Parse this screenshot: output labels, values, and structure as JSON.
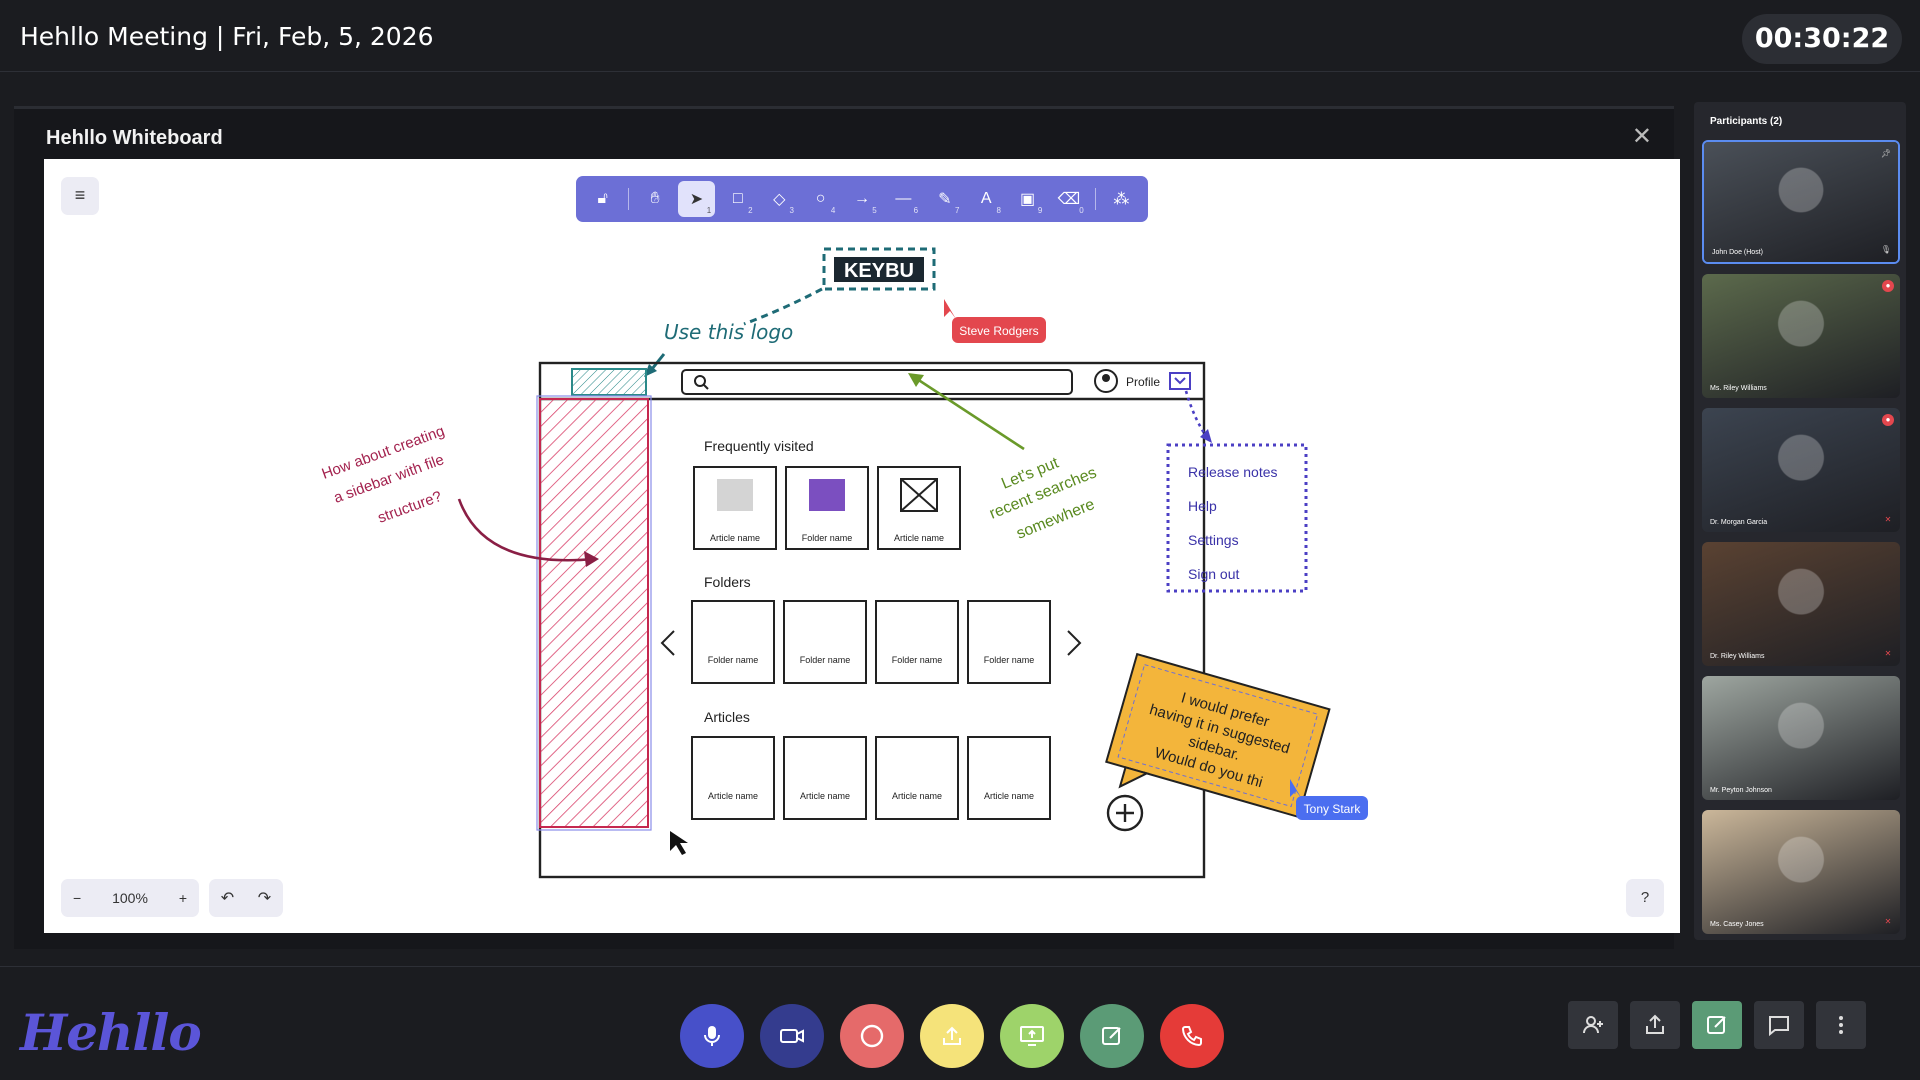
{
  "header": {
    "title": "Hehllo Meeting | Fri, Feb, 5, 2026",
    "timer": "00:30:22"
  },
  "whiteboard": {
    "title": "Hehllo Whiteboard",
    "zoom": "100%",
    "toolbar_numbers": [
      "1",
      "2",
      "3",
      "4",
      "5",
      "6",
      "7",
      "8",
      "9",
      "0"
    ],
    "sketch": {
      "logo_text": "KEYBU",
      "use_logo": "Use this logo",
      "steve_label": "Steve Rodgers",
      "tony_label": "Tony Stark",
      "profile": "Profile",
      "sidebar_note": [
        "How about creating",
        "a sidebar with file",
        "structure?"
      ],
      "search_note": [
        "Let's put",
        "recent searches",
        "somewhere"
      ],
      "frequently_visited": "Frequently visited",
      "fv_items": [
        "Article name",
        "Folder name",
        "Article name"
      ],
      "folders": "Folders",
      "folder_items": [
        "Folder name",
        "Folder name",
        "Folder name",
        "Folder name"
      ],
      "articles": "Articles",
      "article_items": [
        "Article name",
        "Article name",
        "Article name",
        "Article name"
      ],
      "menu": [
        "Release notes",
        "Help",
        "Settings",
        "Sign out"
      ],
      "sticky": [
        "I would prefer",
        "having it in suggested",
        "sidebar.",
        "Would do you thi"
      ]
    }
  },
  "participants": {
    "title": "Participants (2)",
    "list": [
      {
        "name": "John Doe (Host)",
        "bg": "#4a5058"
      },
      {
        "name": "Ms. Riley Williams",
        "bg": "#5c6a4c"
      },
      {
        "name": "Dr. Morgan Garcia",
        "bg": "#3c4450"
      },
      {
        "name": "Dr. Riley Williams",
        "bg": "#5a4232"
      },
      {
        "name": "Mr. Peyton Johnson",
        "bg": "#9ea6a0"
      },
      {
        "name": "Ms. Casey Jones",
        "bg": "#cbb79a"
      }
    ]
  },
  "footer": {
    "logo": "Hehllo"
  },
  "colors": {
    "accent": "#6c6fd6",
    "mic": "#4750c9",
    "video": "#343c8e",
    "record": "#e56a6a",
    "share": "#f5e37a",
    "screen": "#9ed36a",
    "note": "#5b9b76",
    "end": "#e53b38"
  }
}
